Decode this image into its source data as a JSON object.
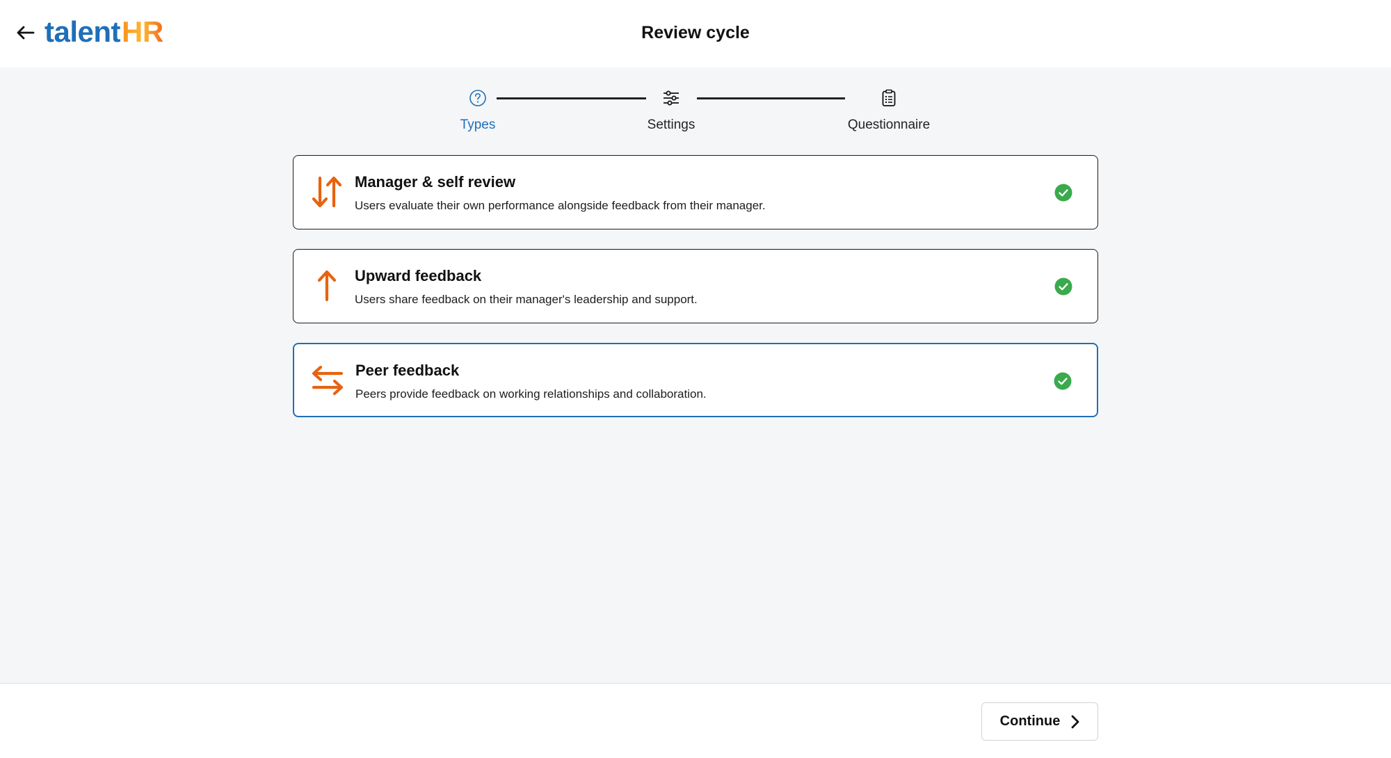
{
  "header": {
    "back_icon": "arrow-left-icon",
    "logo_part1": "talent",
    "logo_part2": "HR",
    "title": "Review cycle"
  },
  "stepper": {
    "steps": [
      {
        "label": "Types",
        "icon": "question-circle-icon",
        "active": true
      },
      {
        "label": "Settings",
        "icon": "sliders-icon",
        "active": false
      },
      {
        "label": "Questionnaire",
        "icon": "clipboard-icon",
        "active": false
      }
    ]
  },
  "review_types": [
    {
      "title": "Manager & self review",
      "description": "Users evaluate their own performance alongside feedback from their manager.",
      "icon": "arrows-up-down-icon",
      "checked": true,
      "selected": false
    },
    {
      "title": "Upward feedback",
      "description": "Users share feedback on their manager's leadership and support.",
      "icon": "arrow-up-icon",
      "checked": true,
      "selected": false
    },
    {
      "title": "Peer feedback",
      "description": "Peers provide feedback on working relationships and collaboration.",
      "icon": "arrows-left-right-icon",
      "checked": true,
      "selected": true
    }
  ],
  "footer": {
    "continue_label": "Continue",
    "continue_icon": "chevron-right-icon"
  },
  "colors": {
    "accent_blue": "#1f6fb8",
    "icon_orange": "#e8620f",
    "check_green": "#3aaa4c",
    "background": "#f5f6f8"
  }
}
